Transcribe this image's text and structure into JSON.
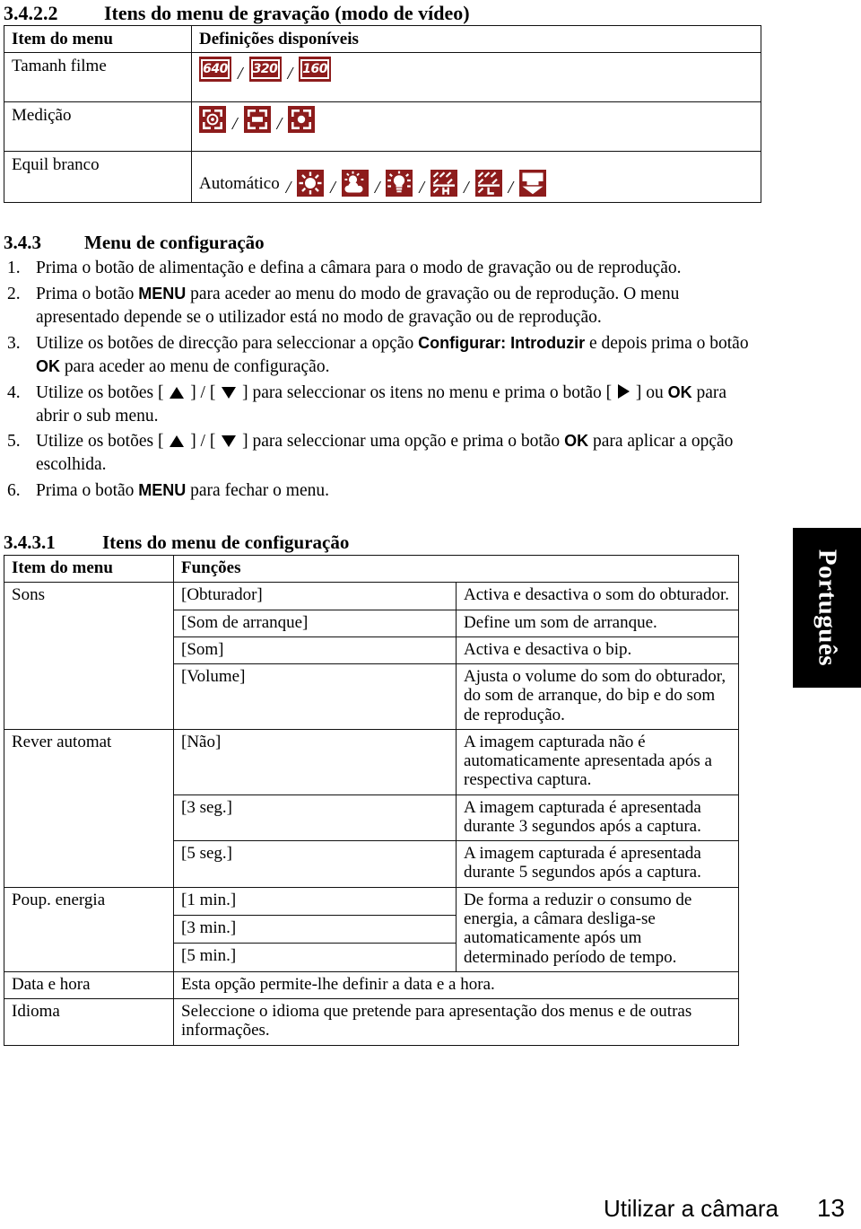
{
  "sections": {
    "rec_menu": {
      "number": "3.4.2.2",
      "title": "Itens do menu de gravação (modo de vídeo)"
    },
    "setup_menu": {
      "number": "3.4.3",
      "title": "Menu de configuração"
    },
    "setup_items": {
      "number": "3.4.3.1",
      "title": "Itens do menu de configuração"
    }
  },
  "rec_table": {
    "headers": {
      "col1": "Item do menu",
      "col2": "Definições disponíveis"
    },
    "rows": [
      {
        "label": "Tamanh filme",
        "kind": "resolution",
        "options": [
          "640",
          "320",
          "160"
        ]
      },
      {
        "label": "Medição",
        "kind": "metering",
        "options": [
          "metering-multi-icon",
          "metering-center-icon",
          "metering-spot-icon"
        ]
      },
      {
        "label": "Equil branco",
        "kind": "whitebalance",
        "auto_label": "Automático",
        "options": [
          "wb-daylight-icon",
          "wb-cloudy-icon",
          "wb-tungsten-icon",
          "wb-fluorescent-h-icon",
          "wb-fluorescent-l-icon",
          "wb-custom-icon"
        ]
      }
    ],
    "separator": "/"
  },
  "steps": [
    {
      "n": "1.",
      "parts": [
        {
          "t": "text",
          "v": "Prima o botão de alimentação e defina a câmara para o modo de gravação ou de reprodução."
        }
      ]
    },
    {
      "n": "2.",
      "parts": [
        {
          "t": "text",
          "v": "Prima o botão "
        },
        {
          "t": "bold",
          "v": "MENU"
        },
        {
          "t": "text",
          "v": " para aceder ao menu do modo de gravação ou de reprodução. O menu apresentado depende se o utilizador está no modo de gravação ou de reprodução."
        }
      ]
    },
    {
      "n": "3.",
      "parts": [
        {
          "t": "text",
          "v": "Utilize os botões de direcção para seleccionar a opção "
        },
        {
          "t": "bold",
          "v": "Configurar: Introduzir"
        },
        {
          "t": "text",
          "v": " e depois prima o botão "
        },
        {
          "t": "bold",
          "v": "OK"
        },
        {
          "t": "text",
          "v": " para aceder ao menu de configuração."
        }
      ]
    },
    {
      "n": "4.",
      "parts": [
        {
          "t": "text",
          "v": "Utilize os botões [ "
        },
        {
          "t": "icon",
          "v": "arrow-up-icon"
        },
        {
          "t": "text",
          "v": " ] / [ "
        },
        {
          "t": "icon",
          "v": "arrow-down-icon"
        },
        {
          "t": "text",
          "v": " ] para seleccionar os itens no menu e prima o botão [ "
        },
        {
          "t": "icon",
          "v": "arrow-right-icon"
        },
        {
          "t": "text",
          "v": " ] ou "
        },
        {
          "t": "bold",
          "v": "OK"
        },
        {
          "t": "text",
          "v": " para abrir o sub menu."
        }
      ]
    },
    {
      "n": "5.",
      "parts": [
        {
          "t": "text",
          "v": "Utilize os botões [ "
        },
        {
          "t": "icon",
          "v": "arrow-up-icon"
        },
        {
          "t": "text",
          "v": " ] / [ "
        },
        {
          "t": "icon",
          "v": "arrow-down-icon"
        },
        {
          "t": "text",
          "v": " ] para seleccionar uma opção e prima o botão "
        },
        {
          "t": "bold",
          "v": "OK"
        },
        {
          "t": "text",
          "v": " para aplicar a opção escolhida."
        }
      ]
    },
    {
      "n": "6.",
      "parts": [
        {
          "t": "text",
          "v": "Prima o botão "
        },
        {
          "t": "bold",
          "v": "MENU"
        },
        {
          "t": "text",
          "v": " para fechar o menu."
        }
      ]
    }
  ],
  "setup_table": {
    "headers": {
      "col1": "Item do menu",
      "col2": "Funções"
    },
    "rows": [
      {
        "item": "Sons",
        "option": "[Obturador]",
        "desc": "Activa e desactiva o som do obturador."
      },
      {
        "item": "",
        "option": "[Som de arranque]",
        "desc": "Define um som de arranque."
      },
      {
        "item": "",
        "option": "[Som]",
        "desc": "Activa e desactiva o bip."
      },
      {
        "item": "",
        "option": "[Volume]",
        "desc": "Ajusta o volume do som do obturador, do som de arranque, do bip e do som de reprodução."
      },
      {
        "item": "Rever automat",
        "option": "[Não]",
        "desc": "A imagem capturada não é automaticamente apresentada após a respectiva captura."
      },
      {
        "item": "",
        "option": "[3 seg.]",
        "desc": "A imagem capturada é apresentada durante 3 segundos após a captura."
      },
      {
        "item": "",
        "option": "[5 seg.]",
        "desc": "A imagem capturada é apresentada durante 5 segundos após a captura."
      },
      {
        "item": "Poup. energia",
        "option": "[1 min.]",
        "desc": "De forma a reduzir o consumo de energia, a câmara desliga-se automaticamente após um determinado período de tempo."
      },
      {
        "item": "",
        "option": "[3 min.]",
        "desc": ""
      },
      {
        "item": "",
        "option": "[5 min.]",
        "desc": ""
      },
      {
        "item": "Data e hora",
        "option": "",
        "desc": "Esta opção permite-lhe definir a data e a hora."
      },
      {
        "item": "Idioma",
        "option": "",
        "desc": "Seleccione o idioma que pretende para apresentação dos menus e de outras informações."
      }
    ]
  },
  "language_tab": {
    "label": "Português"
  },
  "footer": {
    "title": "Utilizar a câmara",
    "page": "13"
  },
  "colors": {
    "icon_red": "#8d1c1c",
    "icon_glyph": "#ffffff",
    "tab_background": "#000000",
    "tab_text": "#ffffff",
    "rule": "#111111"
  }
}
